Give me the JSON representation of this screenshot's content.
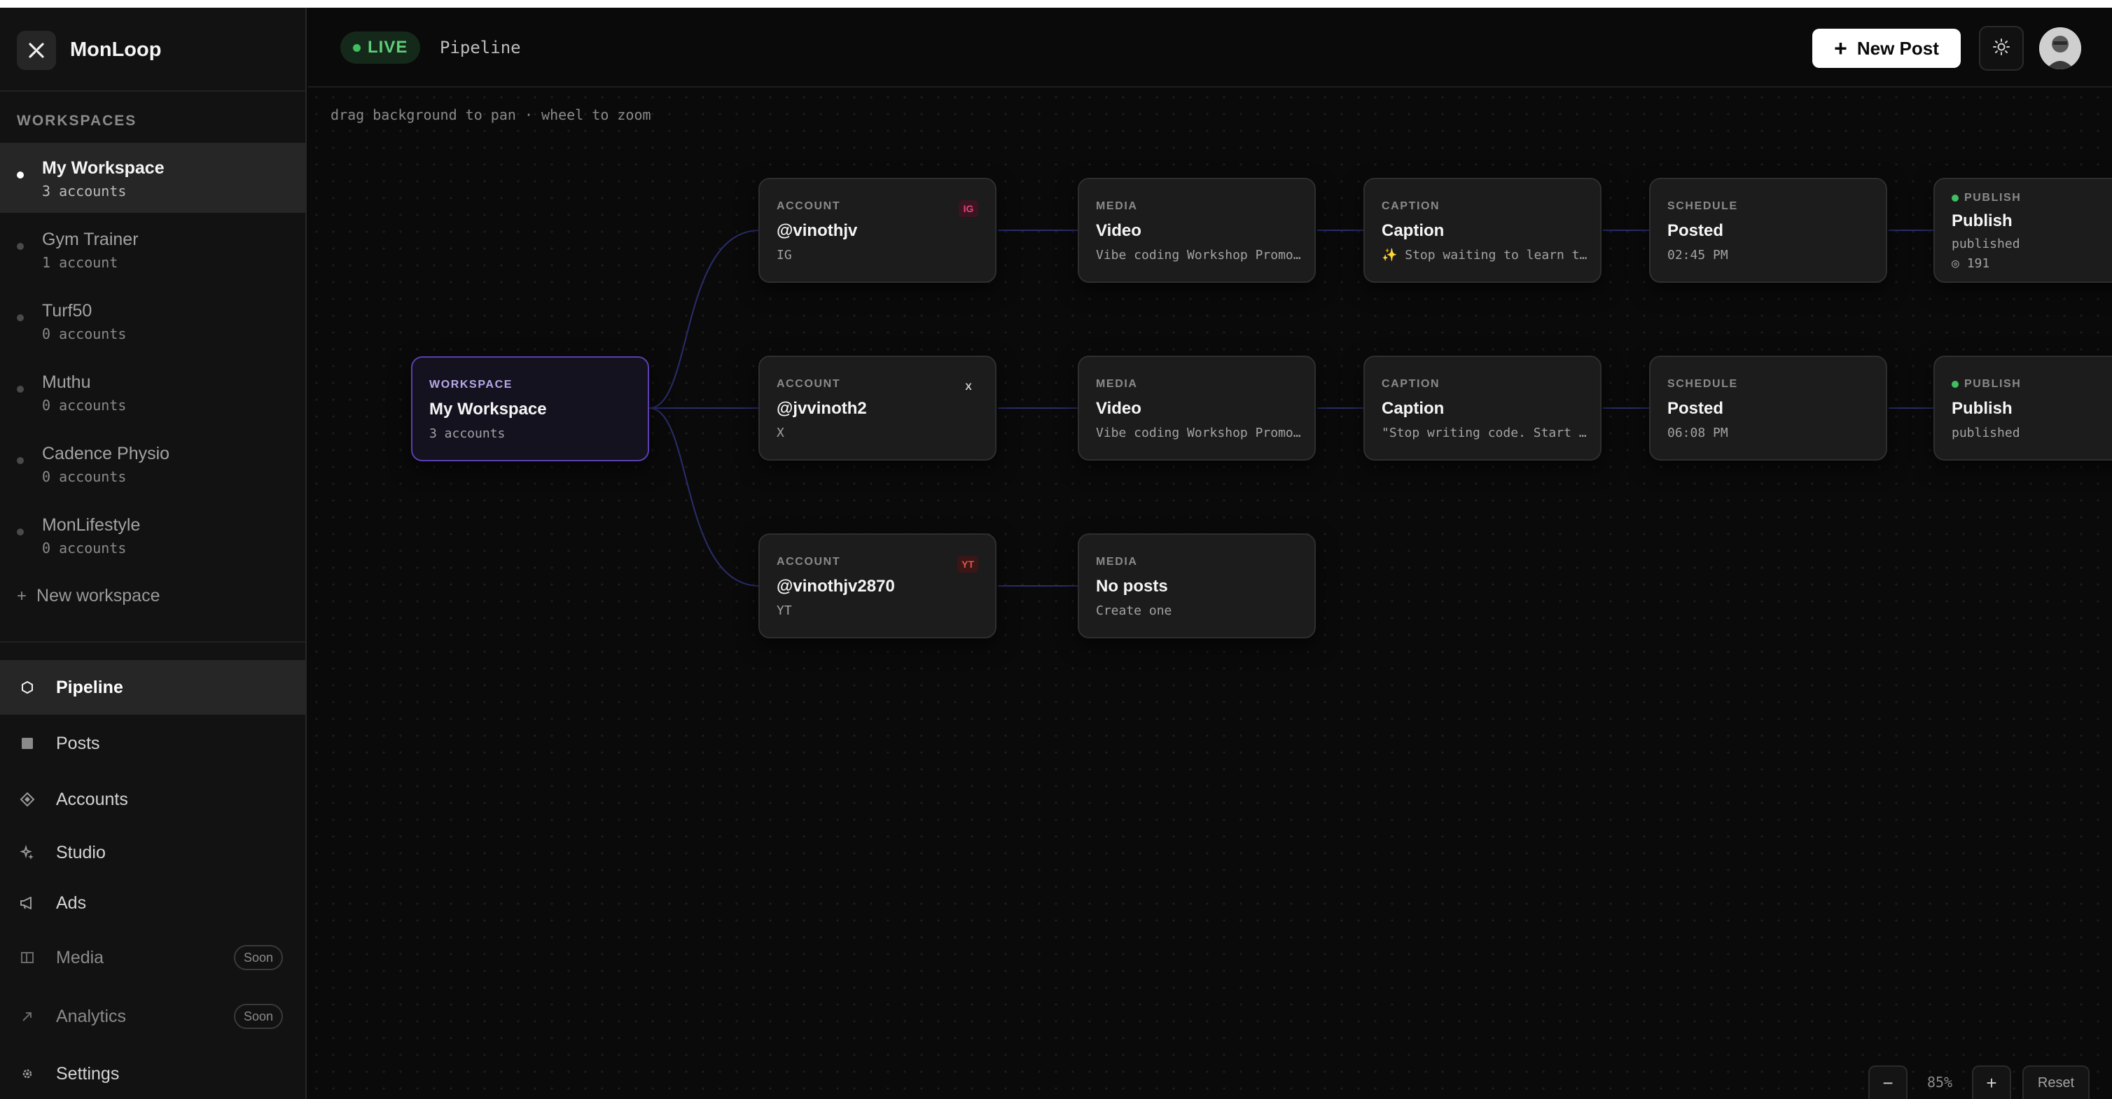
{
  "app": {
    "name": "MonLoop",
    "logo_icon": "loop-x-icon"
  },
  "sidebar": {
    "workspaces_heading": "WORKSPACES",
    "workspaces": [
      {
        "name": "My Workspace",
        "count": "3 accounts",
        "active": true
      },
      {
        "name": "Gym Trainer",
        "count": "1 account",
        "active": false
      },
      {
        "name": "Turf50",
        "count": "0 accounts",
        "active": false
      },
      {
        "name": "Muthu",
        "count": "0 accounts",
        "active": false
      },
      {
        "name": "Cadence Physio",
        "count": "0 accounts",
        "active": false
      },
      {
        "name": "MonLifestyle",
        "count": "0 accounts",
        "active": false
      }
    ],
    "new_workspace": "New workspace",
    "nav": [
      {
        "label": "Pipeline",
        "icon": "hexagon-icon",
        "active": true
      },
      {
        "label": "Posts",
        "icon": "square-icon"
      },
      {
        "label": "Accounts",
        "icon": "diamond-icon"
      },
      {
        "label": "Studio",
        "icon": "sparkle-icon"
      },
      {
        "label": "Ads",
        "icon": "megaphone-icon"
      },
      {
        "label": "Media",
        "icon": "panel-icon",
        "badge": "Soon"
      },
      {
        "label": "Analytics",
        "icon": "arrow-up-right-icon",
        "badge": "Soon"
      },
      {
        "label": "Settings",
        "icon": "gear-icon"
      }
    ]
  },
  "header": {
    "live_label": "LIVE",
    "breadcrumb": "Pipeline",
    "new_post_label": "New Post",
    "theme_icon": "sun-icon"
  },
  "canvas": {
    "hint": "drag background to pan · wheel to zoom",
    "workspace_node": {
      "type": "WORKSPACE",
      "title": "My Workspace",
      "sub": "3 accounts"
    },
    "rows": [
      {
        "account": {
          "type": "ACCOUNT",
          "handle": "@vinothjv",
          "platform": "IG",
          "badge": "IG"
        },
        "media": {
          "type": "MEDIA",
          "title": "Video",
          "sub": "Vibe coding Workshop Promo …"
        },
        "caption": {
          "type": "CAPTION",
          "title": "Caption",
          "sub": "✨ Stop waiting to learn to…"
        },
        "schedule": {
          "type": "SCHEDULE",
          "title": "Posted",
          "sub": "02:45 PM"
        },
        "publish": {
          "type": "PUBLISH",
          "title": "Publish",
          "sub": "published",
          "views": "191"
        }
      },
      {
        "account": {
          "type": "ACCOUNT",
          "handle": "@jvvinoth2",
          "platform": "X",
          "badge": "X"
        },
        "media": {
          "type": "MEDIA",
          "title": "Video",
          "sub": "Vibe coding Workshop Promo …"
        },
        "caption": {
          "type": "CAPTION",
          "title": "Caption",
          "sub": "\"Stop writing code. Start de"
        },
        "schedule": {
          "type": "SCHEDULE",
          "title": "Posted",
          "sub": "06:08 PM"
        },
        "publish": {
          "type": "PUBLISH",
          "title": "Publish",
          "sub": "published"
        }
      },
      {
        "account": {
          "type": "ACCOUNT",
          "handle": "@vinothjv2870",
          "platform": "YT",
          "badge": "YT"
        },
        "media": {
          "type": "MEDIA",
          "title": "No posts",
          "sub": "Create one"
        }
      }
    ],
    "zoom": {
      "minus": "−",
      "level": "85%",
      "plus": "+",
      "reset": "Reset"
    }
  },
  "colors": {
    "accent_live": "#3fbf5f",
    "workspace_border": "#5b3fb0",
    "edge": "#2a2d6b",
    "ig_badge": "#b3264f",
    "yt_badge": "#c0392b"
  }
}
